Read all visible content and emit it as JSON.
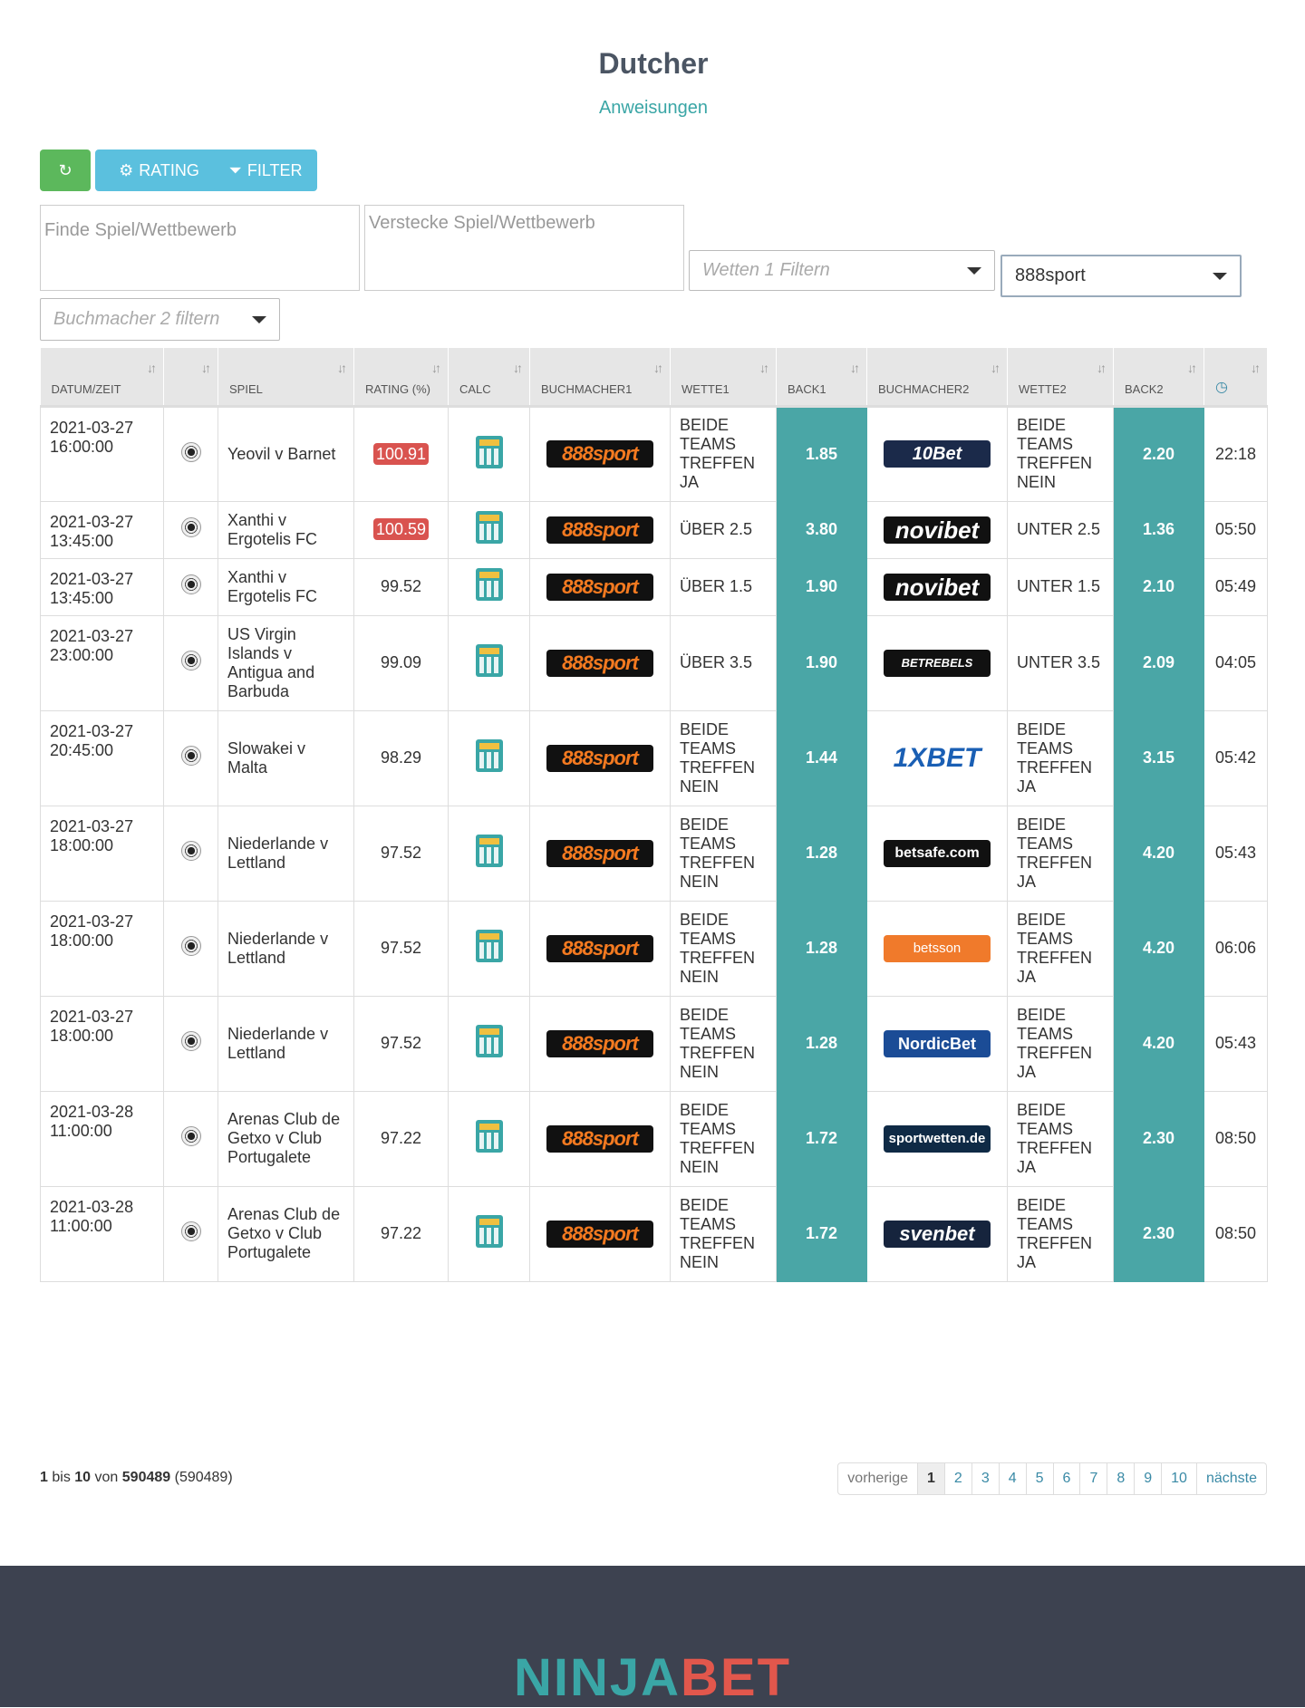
{
  "page": {
    "title": "Dutcher",
    "subtitle": "Anweisungen"
  },
  "toolbar": {
    "refresh_icon": "refresh-icon",
    "rating_label": "RATING",
    "filter_label": "FILTER"
  },
  "filters": {
    "search_placeholder": "Finde Spiel/Wettbewerb",
    "hide_placeholder": "Verstecke Spiel/Wettbewerb",
    "bet1_placeholder": "Wetten 1 Filtern",
    "bookmaker1_value": "888sport",
    "bookmaker2_placeholder": "Buchmacher 2 filtern"
  },
  "table": {
    "headers": [
      "DATUM/ZEIT",
      "",
      "SPIEL",
      "RATING (%)",
      "CALC",
      "BUCHMACHER1",
      "WETTE1",
      "BACK1",
      "BUCHMACHER2",
      "WETTE2",
      "BACK2",
      ""
    ],
    "rows": [
      {
        "date": "2021-03-27",
        "time": "16:00:00",
        "game": "Yeovil v Barnet",
        "rating": "100.91",
        "highlight": true,
        "bm1": "888sport",
        "bet1": "BEIDE TEAMS TREFFEN JA",
        "back1": "1.85",
        "bm2": "10Bet",
        "bm2_style": "l-10bet",
        "bet2": "BEIDE TEAMS TREFFEN NEIN",
        "back2": "2.20",
        "age": "22:18"
      },
      {
        "date": "2021-03-27",
        "time": "13:45:00",
        "game": "Xanthi v Ergotelis FC",
        "rating": "100.59",
        "highlight": true,
        "bm1": "888sport",
        "bet1": "ÜBER 2.5",
        "back1": "3.80",
        "bm2": "novibet",
        "bm2_style": "l-novibet",
        "bet2": "UNTER 2.5",
        "back2": "1.36",
        "age": "05:50"
      },
      {
        "date": "2021-03-27",
        "time": "13:45:00",
        "game": "Xanthi v Ergotelis FC",
        "rating": "99.52",
        "highlight": false,
        "bm1": "888sport",
        "bet1": "ÜBER 1.5",
        "back1": "1.90",
        "bm2": "novibet",
        "bm2_style": "l-novibet",
        "bet2": "UNTER 1.5",
        "back2": "2.10",
        "age": "05:49"
      },
      {
        "date": "2021-03-27",
        "time": "23:00:00",
        "game": "US Virgin Islands v Antigua and Barbuda",
        "rating": "99.09",
        "highlight": false,
        "bm1": "888sport",
        "bet1": "ÜBER 3.5",
        "back1": "1.90",
        "bm2": "BETREBELS",
        "bm2_style": "l-betrebels",
        "bet2": "UNTER 3.5",
        "back2": "2.09",
        "age": "04:05"
      },
      {
        "date": "2021-03-27",
        "time": "20:45:00",
        "game": "Slowakei v Malta",
        "rating": "98.29",
        "highlight": false,
        "bm1": "888sport",
        "bet1": "BEIDE TEAMS TREFFEN NEIN",
        "back1": "1.44",
        "bm2": "1XBET",
        "bm2_style": "l-1xbet",
        "bet2": "BEIDE TEAMS TREFFEN JA",
        "back2": "3.15",
        "age": "05:42"
      },
      {
        "date": "2021-03-27",
        "time": "18:00:00",
        "game": "Niederlande v Lettland",
        "rating": "97.52",
        "highlight": false,
        "bm1": "888sport",
        "bet1": "BEIDE TEAMS TREFFEN NEIN",
        "back1": "1.28",
        "bm2": "betsafe.com",
        "bm2_style": "l-betsafe",
        "bet2": "BEIDE TEAMS TREFFEN JA",
        "back2": "4.20",
        "age": "05:43"
      },
      {
        "date": "2021-03-27",
        "time": "18:00:00",
        "game": "Niederlande v Lettland",
        "rating": "97.52",
        "highlight": false,
        "bm1": "888sport",
        "bet1": "BEIDE TEAMS TREFFEN NEIN",
        "back1": "1.28",
        "bm2": "betsson",
        "bm2_style": "l-betsson",
        "bet2": "BEIDE TEAMS TREFFEN JA",
        "back2": "4.20",
        "age": "06:06"
      },
      {
        "date": "2021-03-27",
        "time": "18:00:00",
        "game": "Niederlande v Lettland",
        "rating": "97.52",
        "highlight": false,
        "bm1": "888sport",
        "bet1": "BEIDE TEAMS TREFFEN NEIN",
        "back1": "1.28",
        "bm2": "NordicBet",
        "bm2_style": "l-nordicbet",
        "bet2": "BEIDE TEAMS TREFFEN JA",
        "back2": "4.20",
        "age": "05:43"
      },
      {
        "date": "2021-03-28",
        "time": "11:00:00",
        "game": "Arenas Club de Getxo v Club Portugalete",
        "rating": "97.22",
        "highlight": false,
        "bm1": "888sport",
        "bet1": "BEIDE TEAMS TREFFEN NEIN",
        "back1": "1.72",
        "bm2": "sportwetten.de",
        "bm2_style": "l-sportwetten",
        "bet2": "BEIDE TEAMS TREFFEN JA",
        "back2": "2.30",
        "age": "08:50"
      },
      {
        "date": "2021-03-28",
        "time": "11:00:00",
        "game": "Arenas Club de Getxo v Club Portugalete",
        "rating": "97.22",
        "highlight": false,
        "bm1": "888sport",
        "bet1": "BEIDE TEAMS TREFFEN NEIN",
        "back1": "1.72",
        "bm2": "svenbet",
        "bm2_style": "l-svenbet",
        "bet2": "BEIDE TEAMS TREFFEN JA",
        "back2": "2.30",
        "age": "08:50"
      }
    ]
  },
  "pagination": {
    "info_from": "1",
    "info_to": "10",
    "info_total": "590489",
    "info_filtered": "590489",
    "prev": "vorherige",
    "next": "nächste",
    "pages": [
      "1",
      "2",
      "3",
      "4",
      "5",
      "6",
      "7",
      "8",
      "9",
      "10"
    ],
    "current": "1"
  },
  "footer": {
    "brand_part1": "NINJA",
    "brand_part2": "BET"
  },
  "colors": {
    "accent": "#4aa6a6",
    "green": "#5cb85c",
    "info": "#5bc0de",
    "danger": "#d9534f"
  }
}
